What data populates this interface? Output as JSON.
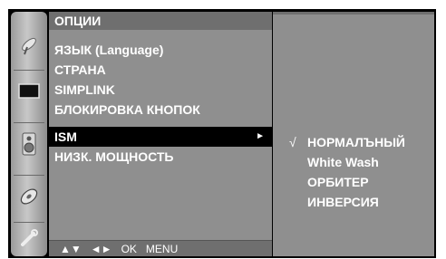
{
  "header": {
    "title": "ОПЦИИ"
  },
  "menu": {
    "items": [
      {
        "label": "ЯЗЫК (Language)"
      },
      {
        "label": "СТРАНА"
      },
      {
        "label": "SIMPLINK"
      },
      {
        "label": "БЛОКИРОВКА КНОПОК"
      },
      {
        "label": "ISM",
        "selected": true,
        "arrow": "►"
      },
      {
        "label": "НИЗК. МОЩНОСТЬ"
      }
    ]
  },
  "submenu": {
    "check_mark": "√",
    "items": [
      {
        "label": "НОРМАЛЪНЫЙ",
        "checked": true
      },
      {
        "label": "White Wash"
      },
      {
        "label": "ОРБИТЕР"
      },
      {
        "label": "ИНВЕРСИЯ"
      }
    ]
  },
  "bottom_bar": {
    "up_down": "▲▼",
    "left_right": "◄►",
    "ok": "OK",
    "menu": "MENU"
  },
  "rail_icons": [
    "satellite-dish-icon",
    "picture-icon",
    "speaker-icon",
    "disc-icon",
    "tools-icon"
  ],
  "colors": {
    "panel": "#8f8f8f",
    "header": "#6f6f6f",
    "selection": "#000000",
    "text": "#ffffff"
  }
}
